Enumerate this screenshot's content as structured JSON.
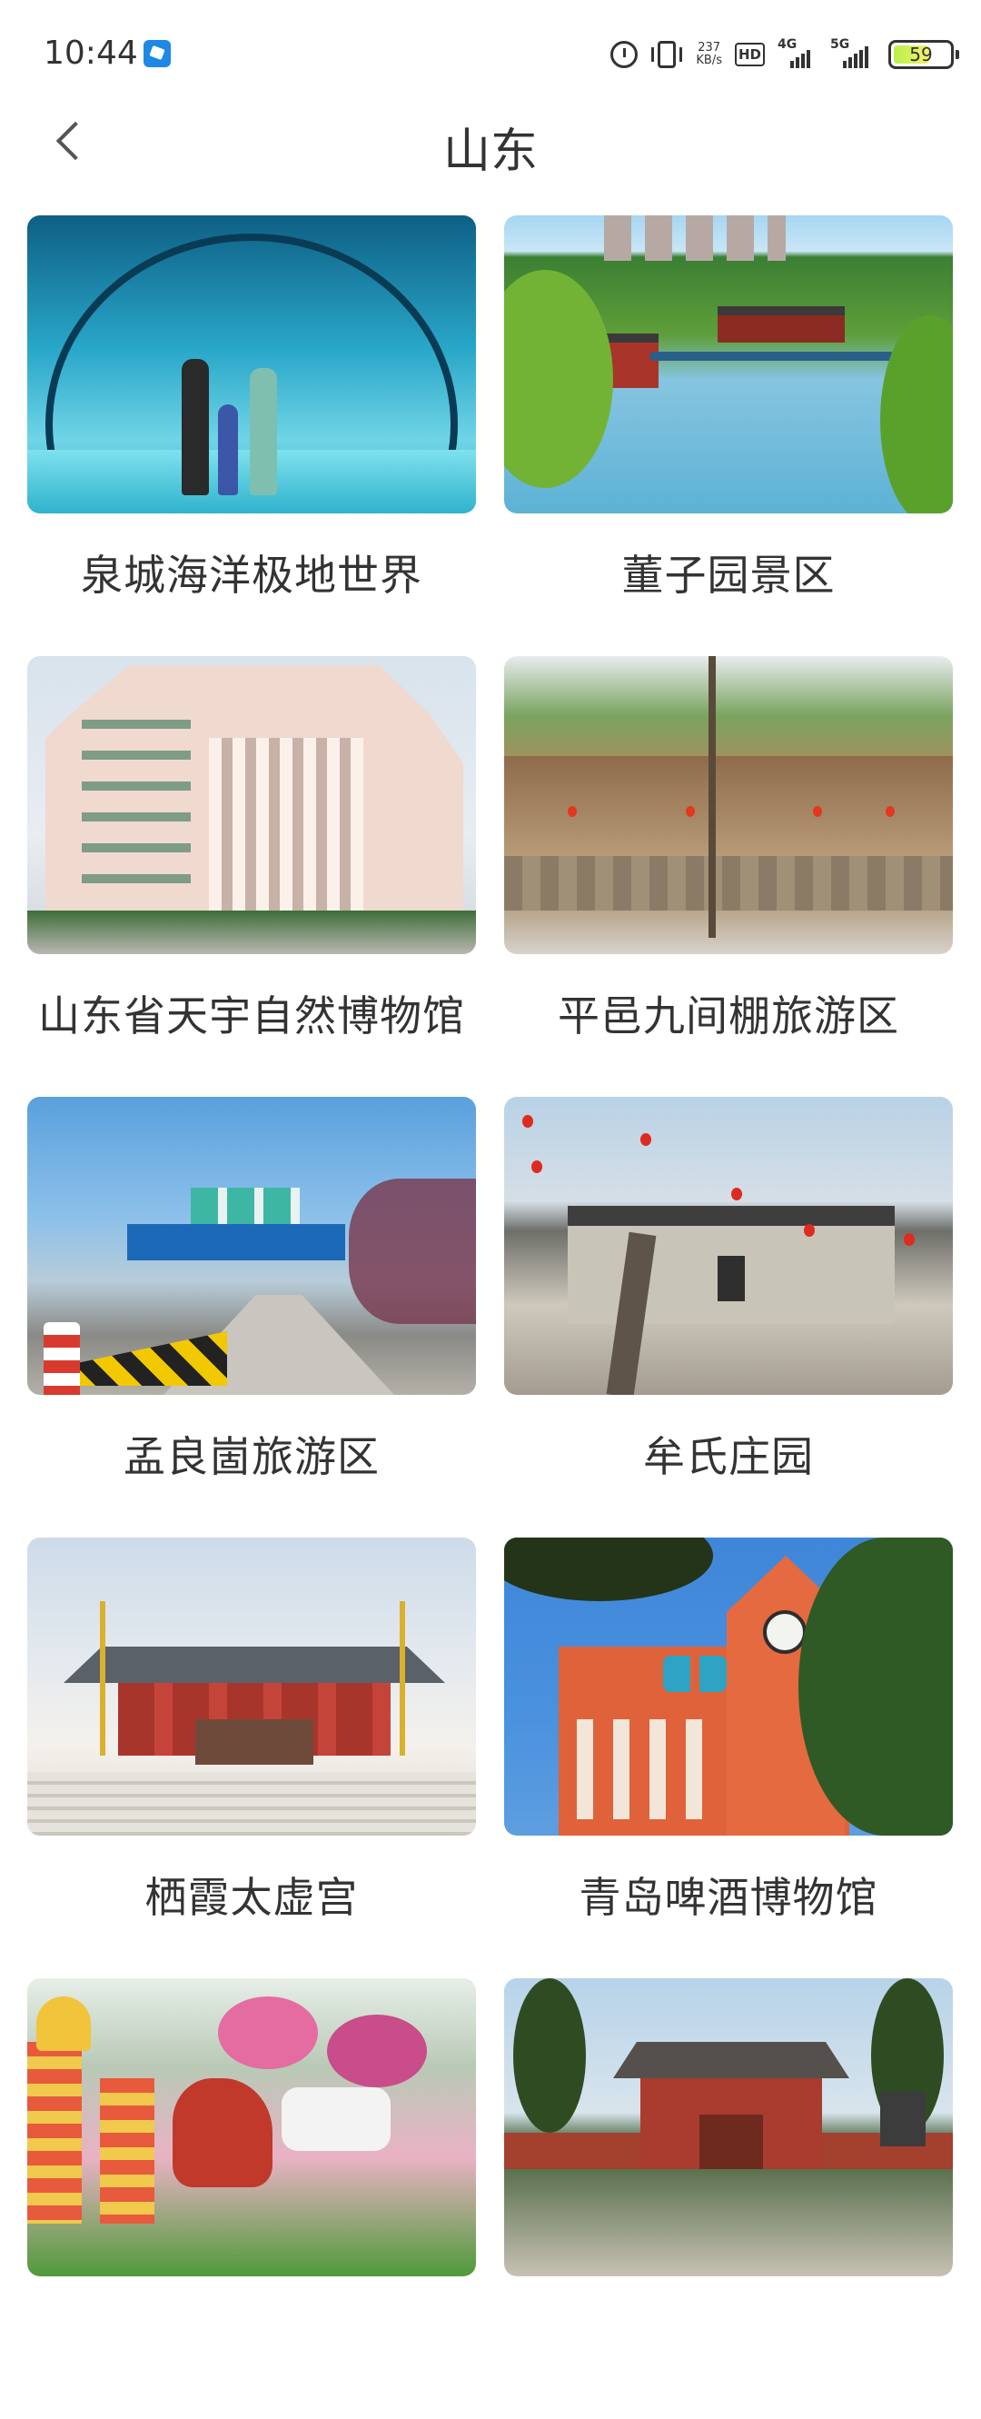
{
  "status_bar": {
    "time": "10:44",
    "speed_value": "237",
    "speed_unit": "KB/s",
    "hd_label": "HD",
    "net1_label": "4G",
    "net2_label": "5G",
    "battery_level": "59"
  },
  "nav": {
    "title": "山东"
  },
  "attractions": [
    {
      "name": "泉城海洋极地世界"
    },
    {
      "name": "董子园景区"
    },
    {
      "name": "山东省天宇自然博物馆"
    },
    {
      "name": "平邑九间棚旅游区"
    },
    {
      "name": "孟良崮旅游区"
    },
    {
      "name": "牟氏庄园"
    },
    {
      "name": "栖霞太虚宫"
    },
    {
      "name": "青岛啤酒博物馆"
    },
    {
      "name": ""
    },
    {
      "name": ""
    }
  ]
}
